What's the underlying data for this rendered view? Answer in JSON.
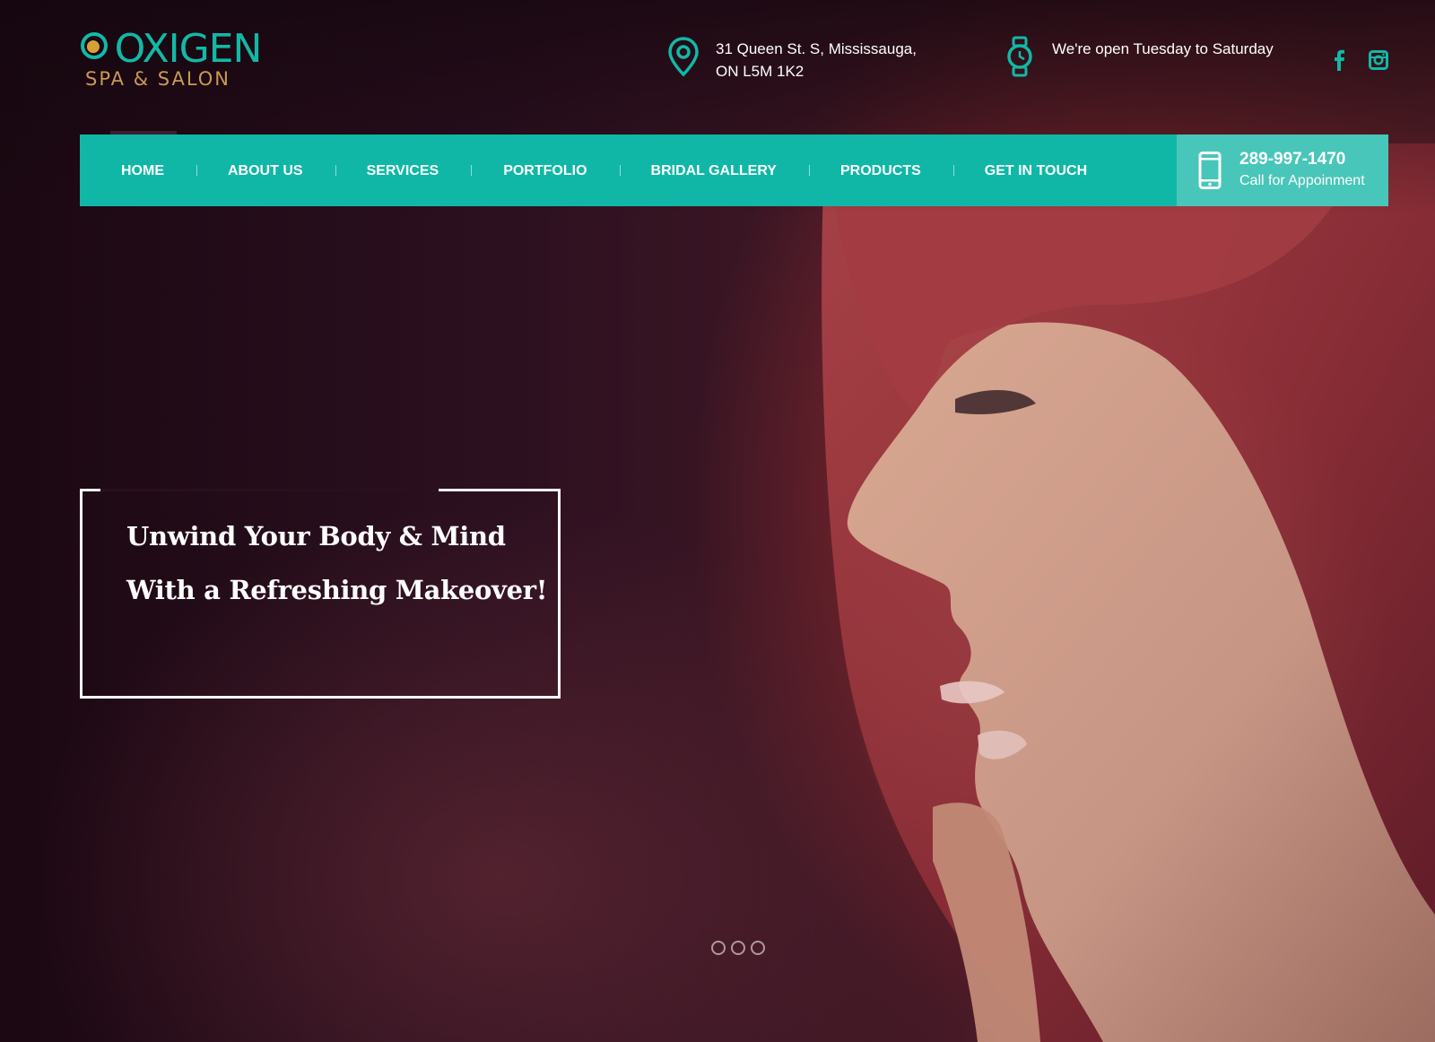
{
  "brand": {
    "name": "OXIGEN",
    "tagline": "SPA & SALON",
    "colors": {
      "accent": "#10b7a6",
      "accent_light": "#48c6b9",
      "logo_gold": "#c89a52"
    }
  },
  "header": {
    "address": {
      "icon": "map-pin-icon",
      "line1": "31 Queen St. S, Mississauga,",
      "line2": "ON L5M 1K2"
    },
    "hours": {
      "icon": "wristwatch-icon",
      "text": "We're open Tuesday to Saturday"
    },
    "social": [
      {
        "icon": "facebook-icon"
      },
      {
        "icon": "instagram-icon"
      }
    ]
  },
  "nav": {
    "items": [
      {
        "label": "HOME",
        "active": true
      },
      {
        "label": "ABOUT US"
      },
      {
        "label": "SERVICES"
      },
      {
        "label": "PORTFOLIO"
      },
      {
        "label": "BRIDAL GALLERY"
      },
      {
        "label": "PRODUCTS"
      },
      {
        "label": "GET IN TOUCH"
      }
    ],
    "call": {
      "icon": "mobile-phone-icon",
      "number": "289-997-1470",
      "label": "Call for Appoinment"
    }
  },
  "hero": {
    "line1": "Unwind Your Body & Mind",
    "line2": "With a Refreshing Makeover!",
    "slides": 3
  }
}
